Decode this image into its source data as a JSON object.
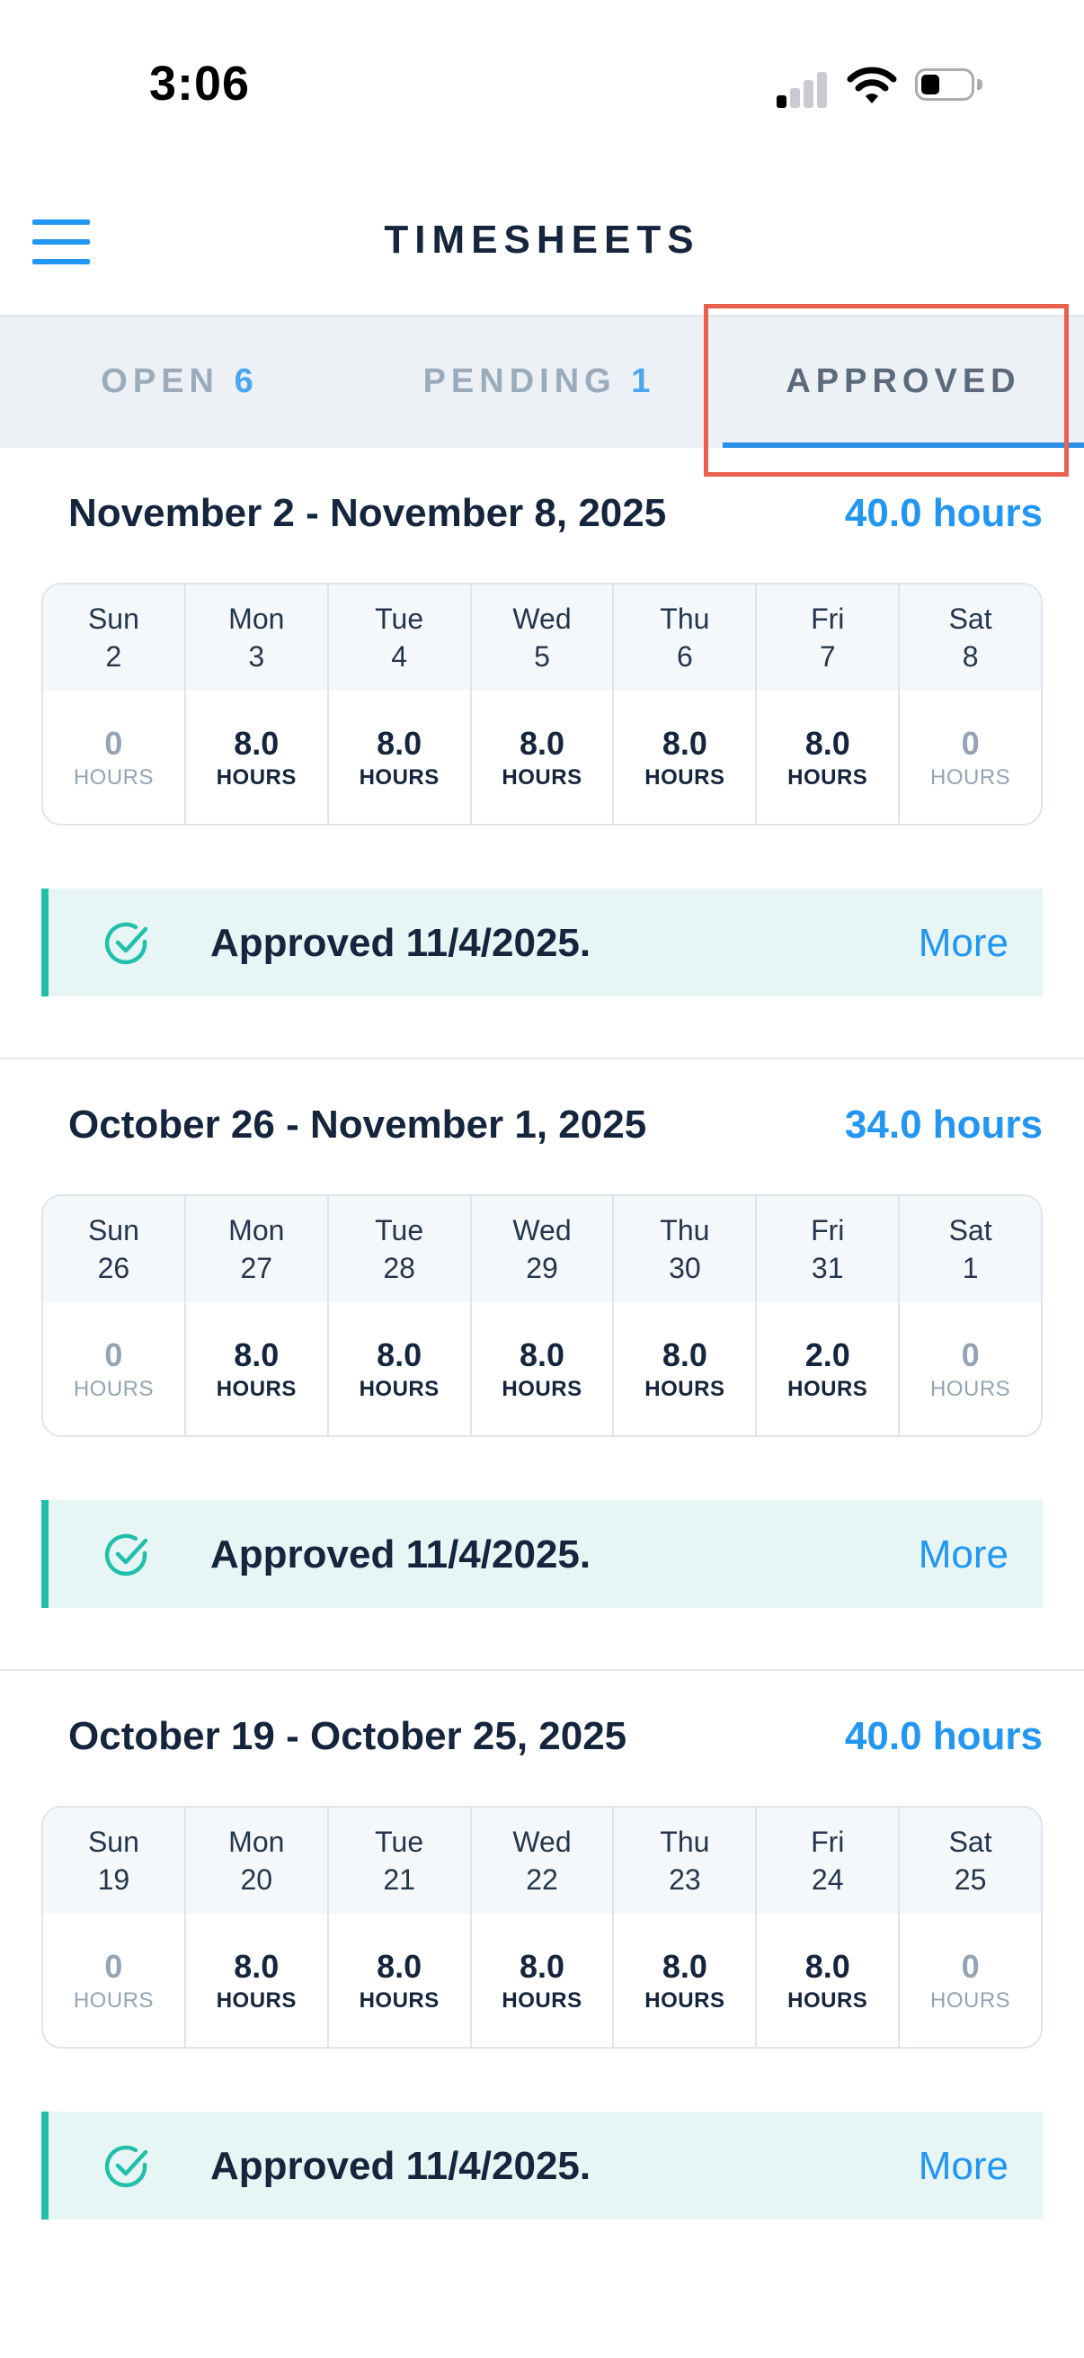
{
  "status_bar": {
    "time": "3:06"
  },
  "header": {
    "title": "TIMESHEETS"
  },
  "tabs": [
    {
      "label": "OPEN",
      "count": "6"
    },
    {
      "label": "PENDING",
      "count": "1"
    },
    {
      "label": "APPROVED",
      "count": ""
    }
  ],
  "active_tab": "APPROVED",
  "colors": {
    "accent": "#2196f3",
    "approved": "#1fbfab",
    "highlight": "#e8604e"
  },
  "weeks": [
    {
      "range": "November 2 - November 8, 2025",
      "total": "40.0 hours",
      "days": [
        {
          "name": "Sun",
          "date": "2",
          "hours": "0",
          "unit": "HOURS"
        },
        {
          "name": "Mon",
          "date": "3",
          "hours": "8.0",
          "unit": "HOURS"
        },
        {
          "name": "Tue",
          "date": "4",
          "hours": "8.0",
          "unit": "HOURS"
        },
        {
          "name": "Wed",
          "date": "5",
          "hours": "8.0",
          "unit": "HOURS"
        },
        {
          "name": "Thu",
          "date": "6",
          "hours": "8.0",
          "unit": "HOURS"
        },
        {
          "name": "Fri",
          "date": "7",
          "hours": "8.0",
          "unit": "HOURS"
        },
        {
          "name": "Sat",
          "date": "8",
          "hours": "0",
          "unit": "HOURS"
        }
      ],
      "status": "Approved 11/4/2025.",
      "more": "More"
    },
    {
      "range": "October 26 - November 1, 2025",
      "total": "34.0 hours",
      "days": [
        {
          "name": "Sun",
          "date": "26",
          "hours": "0",
          "unit": "HOURS"
        },
        {
          "name": "Mon",
          "date": "27",
          "hours": "8.0",
          "unit": "HOURS"
        },
        {
          "name": "Tue",
          "date": "28",
          "hours": "8.0",
          "unit": "HOURS"
        },
        {
          "name": "Wed",
          "date": "29",
          "hours": "8.0",
          "unit": "HOURS"
        },
        {
          "name": "Thu",
          "date": "30",
          "hours": "8.0",
          "unit": "HOURS"
        },
        {
          "name": "Fri",
          "date": "31",
          "hours": "2.0",
          "unit": "HOURS"
        },
        {
          "name": "Sat",
          "date": "1",
          "hours": "0",
          "unit": "HOURS"
        }
      ],
      "status": "Approved 11/4/2025.",
      "more": "More"
    },
    {
      "range": "October 19 - October 25, 2025",
      "total": "40.0 hours",
      "days": [
        {
          "name": "Sun",
          "date": "19",
          "hours": "0",
          "unit": "HOURS"
        },
        {
          "name": "Mon",
          "date": "20",
          "hours": "8.0",
          "unit": "HOURS"
        },
        {
          "name": "Tue",
          "date": "21",
          "hours": "8.0",
          "unit": "HOURS"
        },
        {
          "name": "Wed",
          "date": "22",
          "hours": "8.0",
          "unit": "HOURS"
        },
        {
          "name": "Thu",
          "date": "23",
          "hours": "8.0",
          "unit": "HOURS"
        },
        {
          "name": "Fri",
          "date": "24",
          "hours": "8.0",
          "unit": "HOURS"
        },
        {
          "name": "Sat",
          "date": "25",
          "hours": "0",
          "unit": "HOURS"
        }
      ],
      "status": "Approved 11/4/2025.",
      "more": "More"
    }
  ]
}
